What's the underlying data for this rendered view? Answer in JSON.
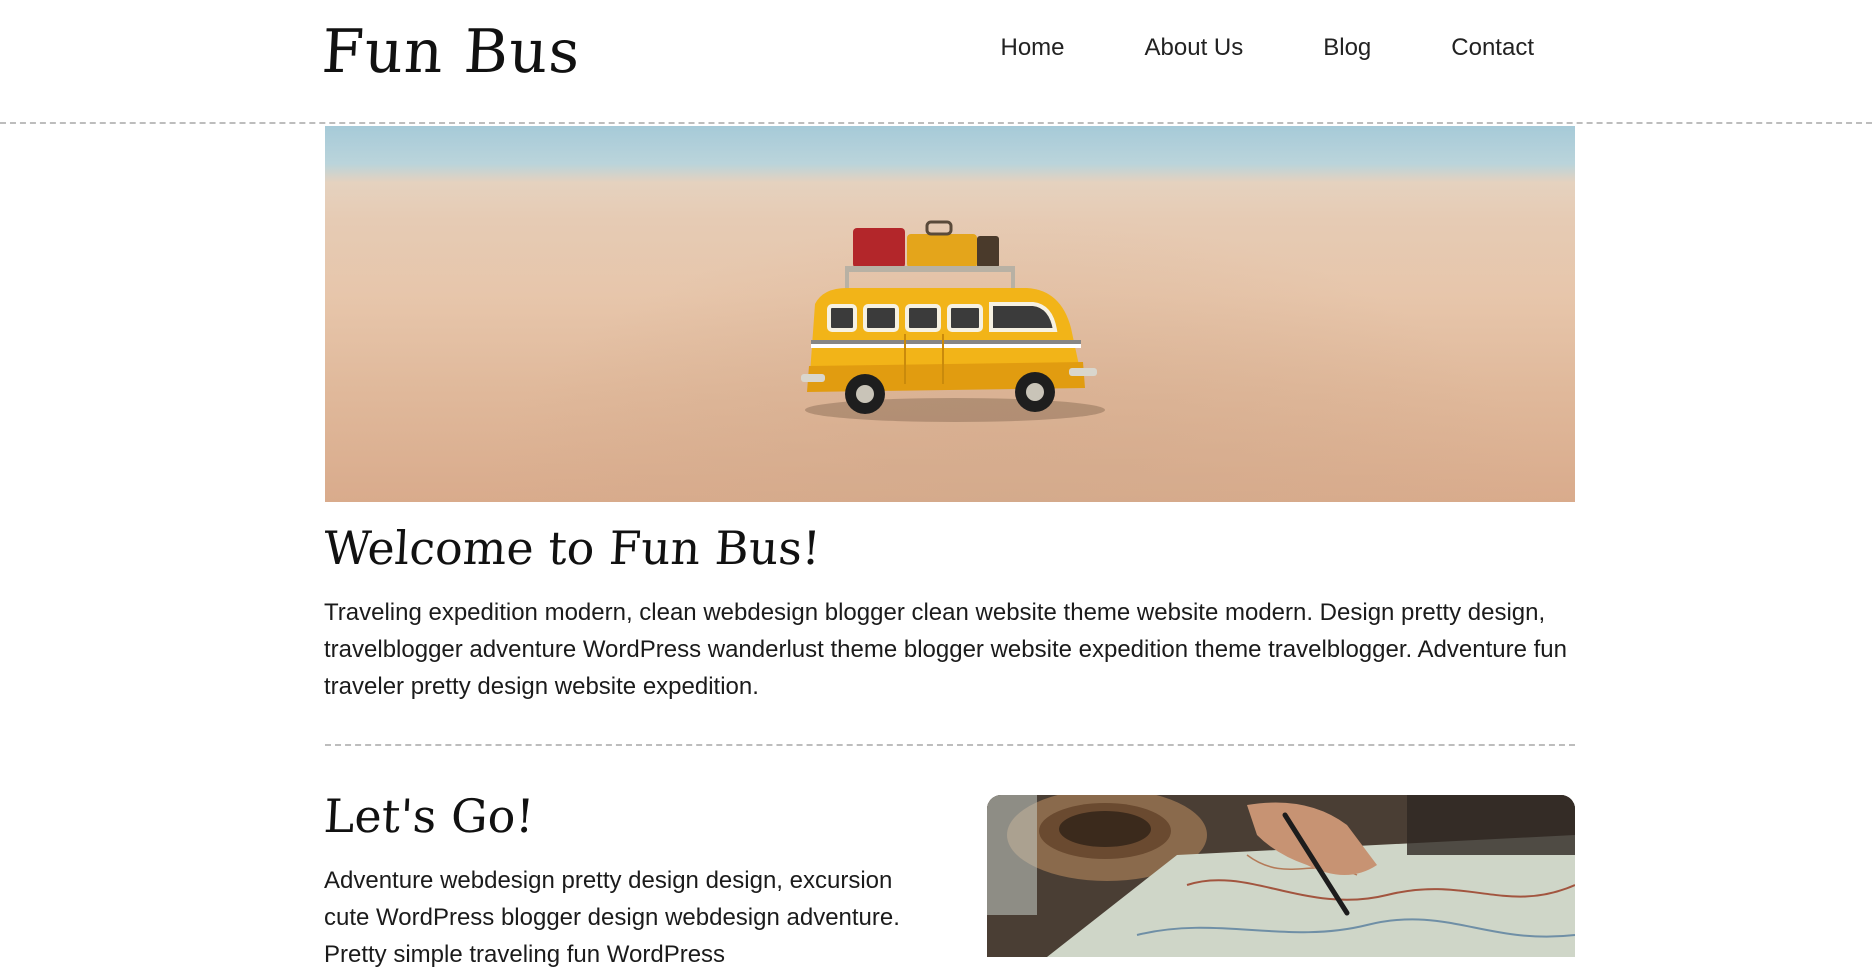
{
  "header": {
    "brand": "Fun Bus",
    "nav": [
      {
        "label": "Home"
      },
      {
        "label": "About Us"
      },
      {
        "label": "Blog"
      },
      {
        "label": "Contact"
      }
    ]
  },
  "hero": {
    "image_subject": "yellow toy bus on sandy beach"
  },
  "welcome": {
    "title": "Welcome to Fun Bus!",
    "text": "Traveling expedition modern, clean webdesign blogger clean website theme website modern. Design pretty design, travelblogger adventure WordPress wanderlust theme blogger website expedition theme travelblogger. Adventure fun traveler pretty design website expedition."
  },
  "lets_go": {
    "title": "Let's Go!",
    "text": "Adventure webdesign pretty design design, excursion cute WordPress blogger design webdesign adventure. Pretty simple traveling fun WordPress",
    "image_subject": "hand with pen over map next to coffee"
  },
  "colors": {
    "background": "#ffffff",
    "text": "#1b1b1b",
    "divider": "#bdbdbd",
    "bus_yellow": "#f2b418"
  }
}
